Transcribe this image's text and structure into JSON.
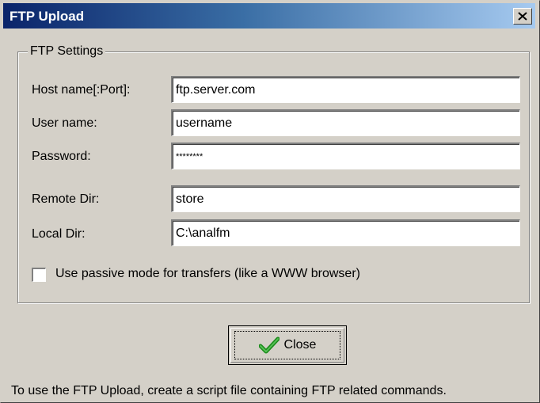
{
  "window": {
    "title": "FTP Upload"
  },
  "group": {
    "legend": "FTP Settings"
  },
  "fields": {
    "host": {
      "label": "Host name[:Port]:",
      "value": "ftp.server.com"
    },
    "user": {
      "label": "User name:",
      "value": "username"
    },
    "password": {
      "label": "Password:",
      "value": "********"
    },
    "remote": {
      "label": "Remote Dir:",
      "value": "store"
    },
    "local": {
      "label": "Local Dir:",
      "value": "C:\\analfm"
    }
  },
  "passive": {
    "label": "Use passive mode for transfers (like a WWW browser)",
    "checked": false
  },
  "buttons": {
    "close_label": "Close"
  },
  "footer": {
    "text": "To use the FTP Upload, create a script file containing FTP related commands."
  },
  "colors": {
    "title_start": "#0a246a",
    "title_end": "#a6caf0",
    "face": "#d4d0c8",
    "check_green": "#1a8a1a"
  },
  "icons": {
    "title_close": "close-icon",
    "button": "checkmark-icon"
  }
}
